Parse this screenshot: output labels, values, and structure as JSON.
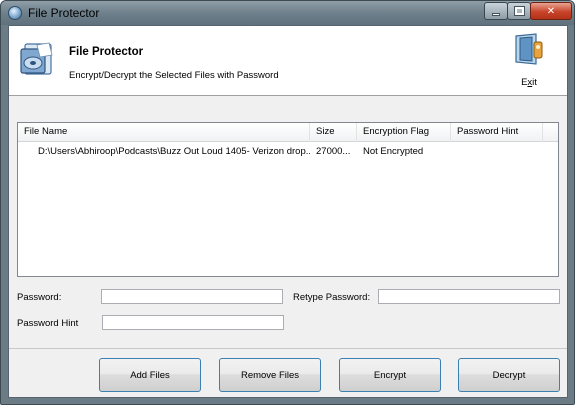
{
  "window": {
    "title": "File Protector"
  },
  "header": {
    "title": "File Protector",
    "subtitle": "Encrypt/Decrypt the Selected Files with Password",
    "exit_label_accel": "x",
    "exit_label_prefix": "E",
    "exit_label_suffix": "it"
  },
  "table": {
    "columns": [
      "File Name",
      "Size",
      "Encryption Flag",
      "Password Hint",
      ""
    ],
    "rows": [
      {
        "file_name": "D:\\Users\\Abhiroop\\Podcasts\\Buzz Out Loud 1405- Verizon drop...",
        "size": "27000...",
        "encryption_flag": "Not Encrypted",
        "password_hint": ""
      }
    ]
  },
  "form": {
    "password_label": "Password:",
    "password_value": "",
    "retype_label": "Retype Password:",
    "retype_value": "",
    "hint_label": "Password Hint",
    "hint_value": ""
  },
  "buttons": {
    "add_files": "Add Files",
    "remove_files": "Remove Files",
    "encrypt": "Encrypt",
    "decrypt": "Decrypt"
  },
  "colors": {
    "button_border": "#3c7fb1",
    "close_button": "#c8442a",
    "titlebar": "#6e808b"
  },
  "icons": {
    "app": "file-protector-app-icon",
    "logo": "file-protector-logo-icon",
    "exit": "exit-door-icon"
  }
}
